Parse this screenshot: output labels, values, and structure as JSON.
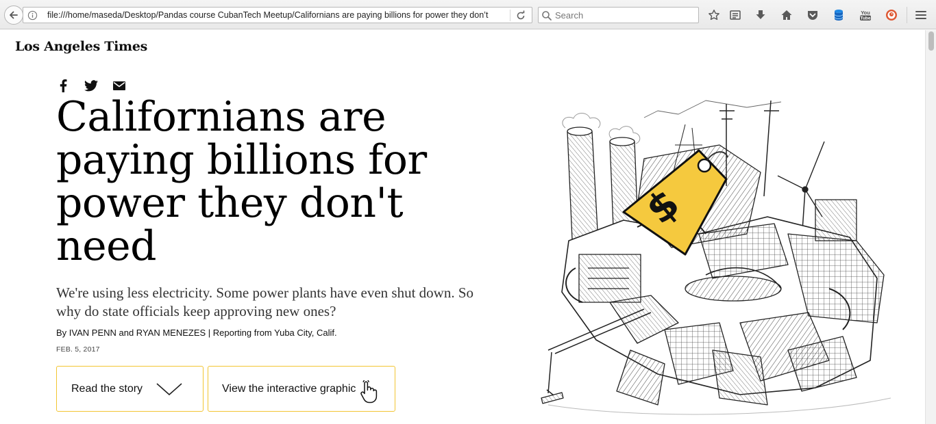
{
  "browser": {
    "url": "file:///home/maseda/Desktop/Pandas course CubanTech Meetup/Californians are paying billions for power they don’t",
    "search_placeholder": "Search",
    "toolbar_icons": [
      "star-icon",
      "reading-list-icon",
      "download-icon",
      "home-icon",
      "pocket-icon",
      "database-icon",
      "youtube-icon",
      "duckduckgo-icon",
      "menu-icon"
    ]
  },
  "article": {
    "publication": "Los Angeles Times",
    "share": [
      "facebook-icon",
      "twitter-icon",
      "mail-icon"
    ],
    "headline": "Californians are paying billions for power they don't need",
    "dek": "We're using less electricity. Some power plants have even shut down. So why do state officials keep approving new ones?",
    "byline": "By IVAN PENN and RYAN MENEZES | Reporting from Yuba City, Calif.",
    "date": "FEB. 5, 2017",
    "buttons": {
      "read_story": "Read the story",
      "interactive": "View the interactive graphic"
    },
    "illustration": {
      "tag_symbol": "$",
      "tag_color": "#f5c93e"
    }
  }
}
